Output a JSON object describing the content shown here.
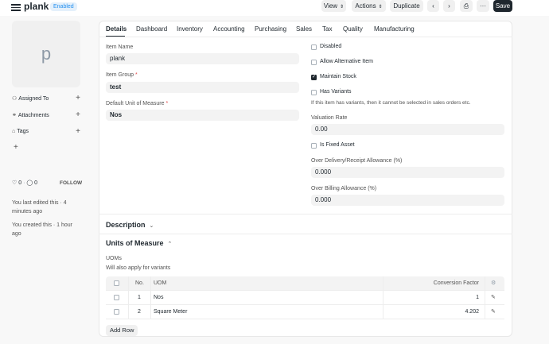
{
  "header": {
    "title": "plank",
    "status_badge": "Enabled",
    "view_button": "View",
    "actions_button": "Actions",
    "duplicate_button": "Duplicate",
    "save_button": "Save"
  },
  "sidebar": {
    "avatar_letter": "p",
    "assigned_to": "Assigned To",
    "attachments": "Attachments",
    "tags": "Tags",
    "likes_count": "0",
    "comments_count": "0",
    "follow": "FOLLOW",
    "last_edited": "You last edited this · 4 minutes ago",
    "created": "You created this · 1 hour ago"
  },
  "tabs": [
    "Details",
    "Dashboard",
    "Inventory",
    "Accounting",
    "Purchasing",
    "Sales",
    "Tax",
    "Quality",
    "Manufacturing"
  ],
  "details": {
    "item_name_label": "Item Name",
    "item_name_value": "plank",
    "item_group_label": "Item Group",
    "item_group_value": "test",
    "uom_label": "Default Unit of Measure",
    "uom_value": "Nos",
    "disabled_label": "Disabled",
    "allow_alt_label": "Allow Alternative Item",
    "maintain_stock_label": "Maintain Stock",
    "has_variants_label": "Has Variants",
    "has_variants_hint": "If this item has variants, then it cannot be selected in sales orders etc.",
    "valuation_rate_label": "Valuation Rate",
    "valuation_rate_value": "0.00",
    "fixed_asset_label": "Is Fixed Asset",
    "over_delivery_label": "Over Delivery/Receipt Allowance (%)",
    "over_delivery_value": "0.000",
    "over_billing_label": "Over Billing Allowance (%)",
    "over_billing_value": "0.000"
  },
  "sections": {
    "description": "Description",
    "units_of_measure": "Units of Measure",
    "uoms_label": "UOMs",
    "uoms_hint": "Will also apply for variants"
  },
  "uom_table": {
    "headers": {
      "no": "No.",
      "uom": "UOM",
      "factor": "Conversion Factor"
    },
    "rows": [
      {
        "no": "1",
        "uom": "Nos",
        "factor": "1"
      },
      {
        "no": "2",
        "uom": "Square Meter",
        "factor": "4.202"
      }
    ],
    "add_row": "Add Row"
  }
}
